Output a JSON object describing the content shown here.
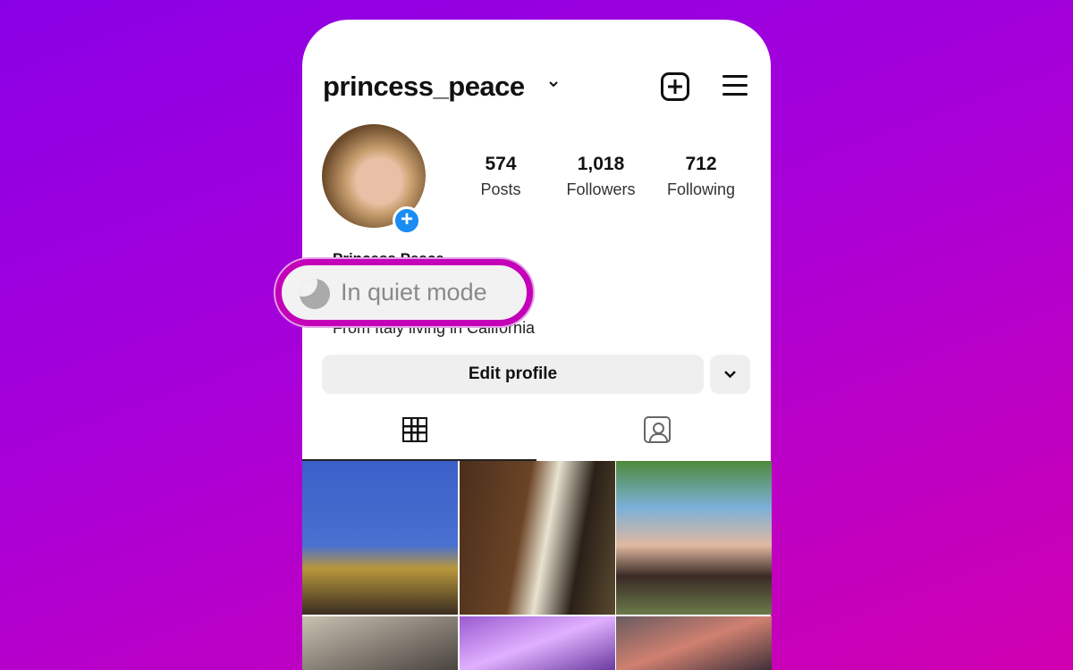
{
  "profile": {
    "username": "princess_peace",
    "display_name": "Princess Peace",
    "bio": "From Italy living in California"
  },
  "stats": [
    {
      "value": "574",
      "label": "Posts"
    },
    {
      "value": "1,018",
      "label": "Followers"
    },
    {
      "value": "712",
      "label": "Following"
    }
  ],
  "actions": {
    "edit_profile": "Edit profile"
  },
  "status": {
    "label": "In quiet mode",
    "icon": "moon-icon"
  },
  "colors": {
    "highlight": "#c400b8",
    "badge": "#1a8cf2"
  }
}
